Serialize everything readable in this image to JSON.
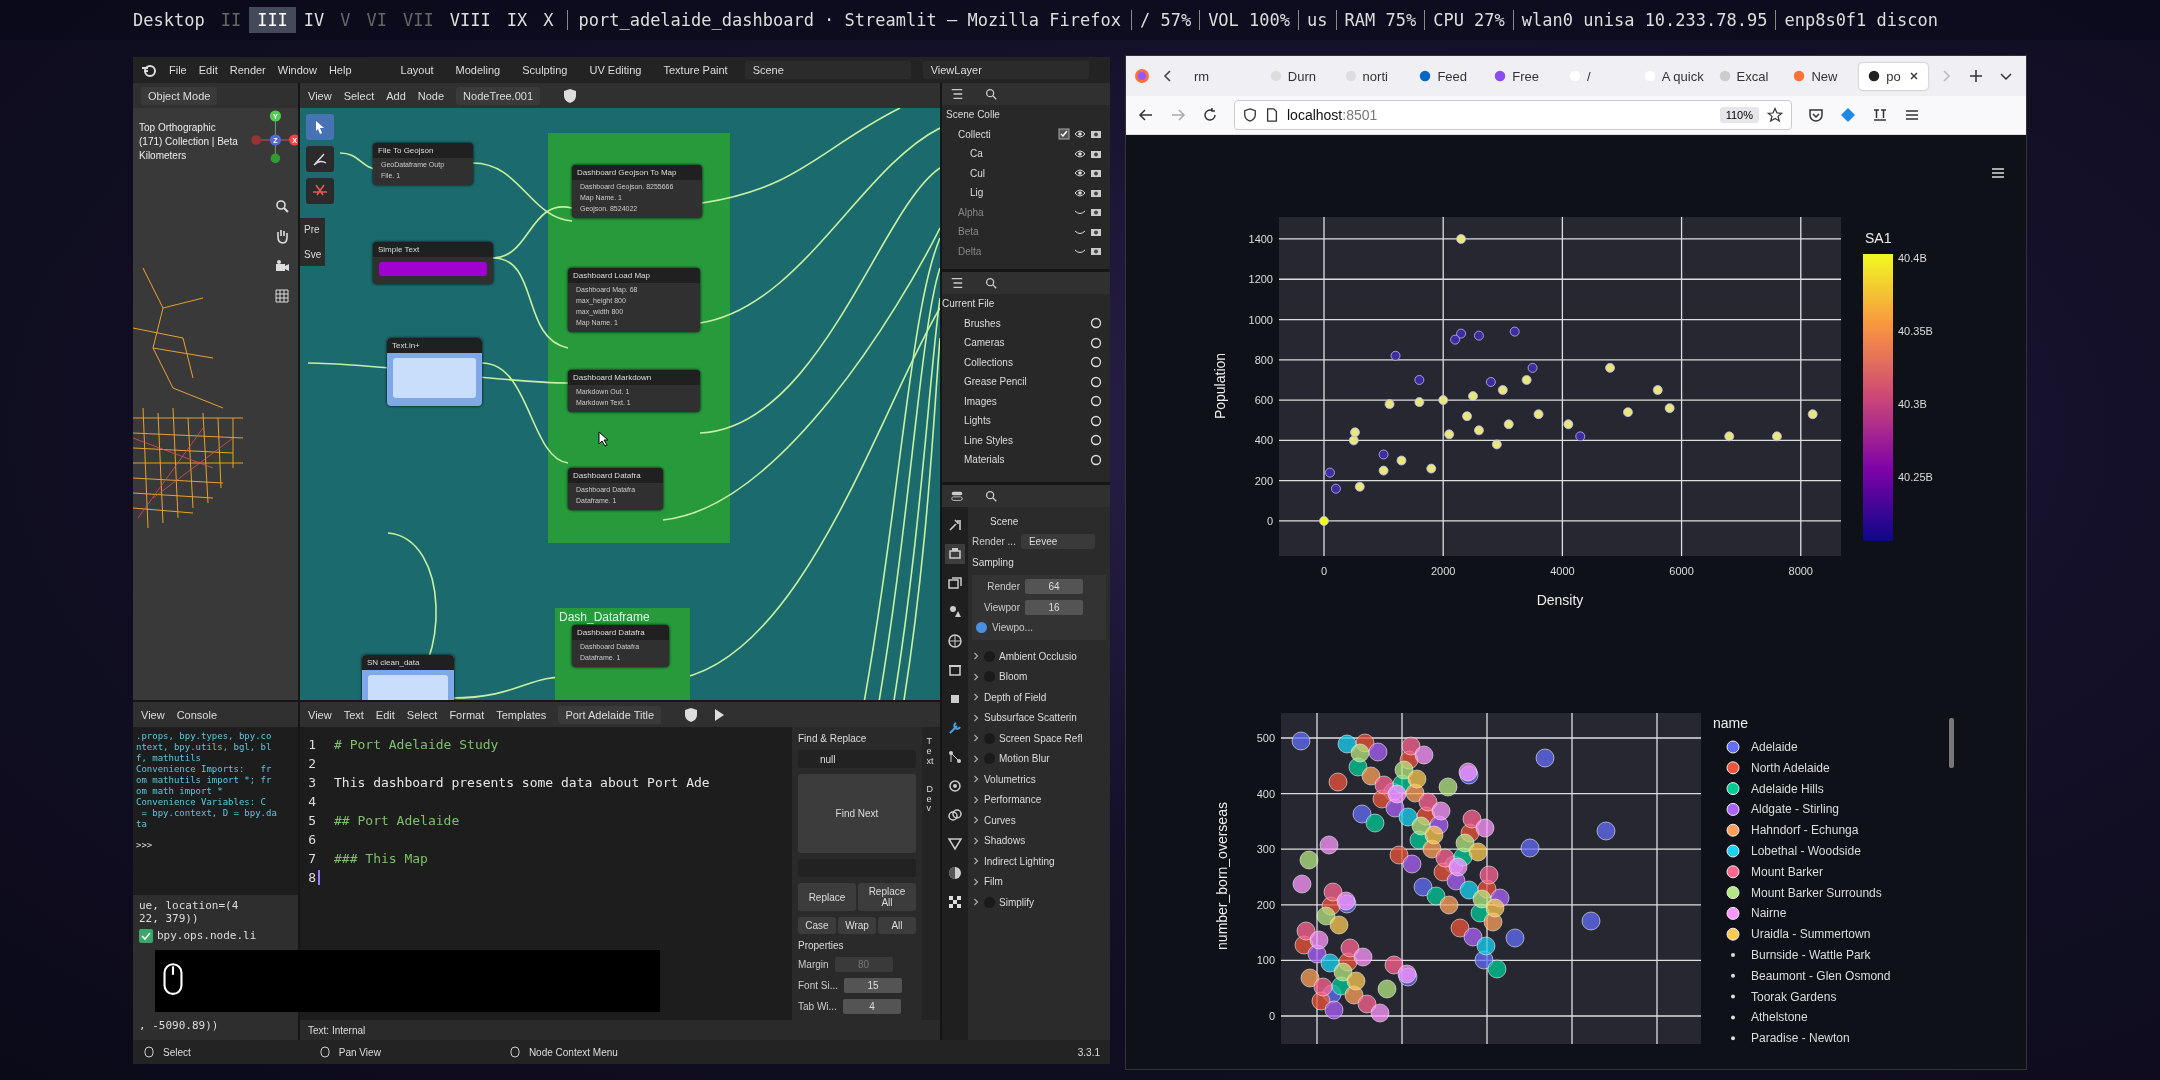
{
  "desktop_bar": {
    "workspaces": [
      {
        "label": "Desktop",
        "selected": false,
        "empty": false
      },
      {
        "label": "II",
        "selected": false,
        "empty": true
      },
      {
        "label": "III",
        "selected": true,
        "empty": false
      },
      {
        "label": "IV",
        "selected": false,
        "empty": false
      },
      {
        "label": "V",
        "selected": false,
        "empty": true
      },
      {
        "label": "VI",
        "selected": false,
        "empty": true
      },
      {
        "label": "VII",
        "selected": false,
        "empty": true
      },
      {
        "label": "VIII",
        "selected": false,
        "empty": false
      },
      {
        "label": "IX",
        "selected": false,
        "empty": false
      },
      {
        "label": "X",
        "selected": false,
        "empty": false
      }
    ],
    "window_title": "port_adelaide_dashboard · Streamlit — Mozilla Firefox",
    "status": [
      "/ 57%",
      "VOL 100%",
      "us",
      "RAM 75%",
      "CPU 27%",
      "wlan0 unisa 10.233.78.95",
      "enp8s0f1 discon"
    ]
  },
  "blender": {
    "menu": [
      "File",
      "Edit",
      "Render",
      "Window",
      "Help"
    ],
    "workspaces": [
      {
        "label": "Layout",
        "selected": false
      },
      {
        "label": "Modeling",
        "selected": false
      },
      {
        "label": "Sculpting",
        "selected": false
      },
      {
        "label": "UV Editing",
        "selected": false
      },
      {
        "label": "Texture Paint",
        "selected": false
      }
    ],
    "scene": "Scene",
    "view_layer": "ViewLayer",
    "viewport": {
      "mode": "Object Mode",
      "info": [
        "Top Orthographic",
        "(171) Collection | Beta",
        "Kilometers"
      ],
      "gizmo_axes": [
        "Y",
        "Z",
        "X"
      ]
    },
    "node_editor": {
      "menu": [
        "View",
        "Select",
        "Add",
        "Node"
      ],
      "tree": "NodeTree.001",
      "side_tabs": [
        "Pre",
        "Sve"
      ],
      "frame_label": "Dash_Dataframe",
      "nodes": [
        {
          "title": "File To Geojson",
          "rows": [
            "GeoDataframe Outp",
            "File. 1"
          ],
          "kind": "plain"
        },
        {
          "title": "Dashboard Geojson To Map",
          "rows": [
            "Dashboard Geojson. 8255666",
            "Map Name. 1",
            "Geojson. 8524022"
          ],
          "kind": "plain"
        },
        {
          "title": "Simple Text",
          "kind": "text"
        },
        {
          "title": "Dashboard Load Map",
          "rows": [
            "Dashboard Map. 68",
            "max_height  800",
            "max_width  800",
            "Map Name. 1"
          ],
          "kind": "plain"
        },
        {
          "title": "Text.in+",
          "kind": "input"
        },
        {
          "title": "Dashboard Markdown",
          "rows": [
            "Markdown Out. 1",
            "Markdown Text. 1"
          ],
          "kind": "plain"
        },
        {
          "title": "Dashboard Datafra",
          "rows": [
            "Dashboard Datafra",
            "Dataframe. 1"
          ],
          "kind": "plain"
        },
        {
          "title": "Dashboard Datafra",
          "rows": [
            "Dashboard Datafra",
            "Dataframe. 1"
          ],
          "kind": "plain"
        },
        {
          "title": "SN clean_data",
          "kind": "input"
        }
      ]
    },
    "outliner": {
      "items": [
        {
          "label": "Scene Colle",
          "children": [
            {
              "label": "Collecti",
              "checked": true,
              "hidden": false,
              "children": [
                {
                  "label": "Ca",
                  "hidden": false
                },
                {
                  "label": "Cul",
                  "hidden": false
                },
                {
                  "label": "Lig",
                  "hidden": false
                }
              ]
            },
            {
              "label": "Alpha",
              "hidden": true
            },
            {
              "label": "Beta",
              "hidden": true
            },
            {
              "label": "Delta",
              "hidden": true
            }
          ]
        }
      ]
    },
    "file_browser": {
      "root": "Current File",
      "items": [
        "Brushes",
        "Cameras",
        "Collections",
        "Grease Pencil",
        "Images",
        "Lights",
        "Line Styles",
        "Materials"
      ]
    },
    "properties": {
      "title": "Scene",
      "engine_label": "Render ...",
      "engine": "Eevee",
      "sampling": "Sampling",
      "fields": [
        {
          "label": "Render",
          "value": "64"
        },
        {
          "label": "Viewpor",
          "value": "16"
        }
      ],
      "denoise": {
        "label": "Viewpo...",
        "checked": true
      },
      "panels": [
        {
          "label": "Ambient Occlusio",
          "kind": "toggle",
          "checked": false
        },
        {
          "label": "Bloom",
          "kind": "toggle",
          "checked": false
        },
        {
          "label": "Depth of Field",
          "kind": "plain"
        },
        {
          "label": "Subsurface Scatterin",
          "kind": "plain"
        },
        {
          "label": "Screen Space Refl",
          "kind": "toggle",
          "checked": false
        },
        {
          "label": "Motion Blur",
          "kind": "toggle",
          "checked": false
        },
        {
          "label": "Volumetrics",
          "kind": "plain"
        },
        {
          "label": "Performance",
          "kind": "plain"
        },
        {
          "label": "Curves",
          "kind": "plain"
        },
        {
          "label": "Shadows",
          "kind": "plain"
        },
        {
          "label": "Indirect Lighting",
          "kind": "plain"
        },
        {
          "label": "Film",
          "kind": "plain"
        },
        {
          "label": "Simplify",
          "kind": "toggle",
          "checked": false
        }
      ]
    },
    "console": {
      "menu": [
        "View",
        "Console"
      ],
      "lines": [
        ".props, bpy.types, bpy.co",
        "ntext, bpy.utils, bgl, bl",
        "f, mathutils",
        "Convenience Imports:   fr",
        "om mathutils import *; fr",
        "om math import *",
        "Convenience Variables: C",
        " = bpy.context, D = bpy.da",
        "ta"
      ],
      "prompt": ">>>",
      "info": [
        {
          "text": "ue, location=(4\n22, 379))",
          "ok": false
        },
        {
          "text": "bpy.ops.node.li",
          "ok": true
        },
        {
          "text": ", -5090.89))",
          "ok": false
        }
      ]
    },
    "text_editor": {
      "menu": [
        "View",
        "Text",
        "Edit",
        "Select",
        "Format",
        "Templates"
      ],
      "file": "Port Adelaide Title",
      "lines": [
        {
          "number": "1",
          "text": "# Port Adelaide Study"
        },
        {
          "number": "2"
        },
        {
          "number": "3",
          "text": "This dashboard presents some data about Port Ade"
        },
        {
          "number": "4"
        },
        {
          "number": "5",
          "text": "## Port Adelaide"
        },
        {
          "number": "6"
        },
        {
          "number": "7",
          "text": "### This Map"
        },
        {
          "number": "8"
        }
      ],
      "footer": "Text: Internal"
    },
    "find_panel": {
      "title": "Find & Replace",
      "find": "null",
      "find_next": "Find Next",
      "replace": [
        "Replace",
        "Replace All"
      ],
      "options": [
        "Case",
        "Wrap",
        "All"
      ],
      "properties_title": "Properties",
      "fields": [
        {
          "label": "Margin",
          "value": "80",
          "disabled": true
        },
        {
          "label": "Font Si...",
          "value": "15",
          "disabled": false
        },
        {
          "label": "Tab Wi...",
          "value": "4",
          "disabled": false
        }
      ],
      "side_tabs": [
        "Text",
        "Dev"
      ]
    },
    "status_bar": {
      "items": [
        "Select",
        "Pan View",
        "Node Context Menu"
      ],
      "version": "3.3.1"
    }
  },
  "firefox": {
    "tabs": [
      {
        "label": "rm",
        "selected": false
      },
      {
        "label": "Durn",
        "selected": false
      },
      {
        "label": "norti",
        "selected": false
      },
      {
        "label": "Feed",
        "selected": false
      },
      {
        "label": "Free",
        "selected": false
      },
      {
        "label": "/",
        "selected": false
      },
      {
        "label": "A quick",
        "selected": false
      },
      {
        "label": "Excal",
        "selected": false
      },
      {
        "label": "New",
        "selected": false
      },
      {
        "label": "po",
        "selected": true
      }
    ],
    "url_host": "localhost",
    "url_port": ":8501",
    "zoom": "110%",
    "scatter": {
      "chart_data": {
        "type": "scatter",
        "xlabel": "Density",
        "ylabel": "Population",
        "grid": true,
        "xlim": [
          -755,
          8675
        ],
        "ylim": [
          -174,
          1509
        ],
        "xticks": [
          0,
          2000,
          4000,
          6000,
          8000
        ],
        "yticks": [
          0,
          200,
          400,
          600,
          800,
          1000,
          1200,
          1400
        ],
        "x": [
          0,
          2300,
          500,
          520,
          1100,
          1600,
          2000,
          2500,
          3000,
          3400,
          600,
          1000,
          1300,
          1800,
          2600,
          3100,
          2900,
          2100,
          3600,
          2400,
          4100,
          4800,
          5100,
          5600,
          5800,
          6800,
          8200,
          7600,
          100,
          200,
          1200,
          1600,
          2300,
          2600,
          3200,
          2200,
          3500,
          2800,
          4300,
          1000
        ],
        "series": [
          {
            "name": "SA1",
            "color": "#e9e77c",
            "values": [
              0,
              1400,
              400,
              440,
              580,
              590,
              600,
              620,
              650,
              700,
              170,
              250,
              300,
              260,
              450,
              480,
              380,
              430,
              530,
              520,
              480,
              760,
              540,
              650,
              560,
              420,
              530,
              420,
              240,
              160,
              820,
              700,
              930,
              920,
              940,
              900,
              760,
              690,
              420,
              330
            ],
            "colors": [
              "#f0f921",
              null,
              null,
              null,
              null,
              null,
              null,
              null,
              null,
              null,
              null,
              null,
              null,
              null,
              null,
              null,
              null,
              null,
              null,
              null,
              null,
              null,
              null,
              null,
              null,
              null,
              null,
              null,
              "#3f2c9e",
              "#3f2c9e",
              "#3f2c9e",
              "#3f2c9e",
              "#3f2c9e",
              "#3f2c9e",
              "#3f2c9e",
              "#3f2c9e",
              "#3f2c9e",
              "#3f2c9e",
              "#3f2c9e",
              "#3f2c9e"
            ]
          }
        ]
      },
      "colorbar": {
        "labels": [
          "40.4B",
          "40.35B",
          "40.3B",
          "40.25B"
        ]
      }
    },
    "bubbles": {
      "ylabel": "number_born_overseas",
      "yticks": [
        "500",
        "400",
        "300",
        "200",
        "100",
        "0"
      ],
      "legend_title": "name",
      "legend": [
        {
          "label": "Adelaide",
          "color": "#636efa"
        },
        {
          "label": "North Adelaide",
          "color": "#ef553b"
        },
        {
          "label": "Adelaide Hills",
          "color": "#00cc96"
        },
        {
          "label": "Aldgate - Stirling",
          "color": "#ab63fa"
        },
        {
          "label": "Hahndorf - Echunga",
          "color": "#ffa15a"
        },
        {
          "label": "Lobethal - Woodside",
          "color": "#19d3f3"
        },
        {
          "label": "Mount Barker",
          "color": "#ff6692"
        },
        {
          "label": "Mount Barker Surrounds",
          "color": "#b6e880"
        },
        {
          "label": "Nairne",
          "color": "#ff97ff"
        },
        {
          "label": "Uraidla - Summertown",
          "color": "#fecb52"
        }
      ],
      "hidden_entries": [
        "Burnside - Wattle Park",
        "Beaumont - Glen Osmond",
        "Toorak Gardens",
        "Athelstone",
        "Paradise - Newton"
      ]
    }
  }
}
